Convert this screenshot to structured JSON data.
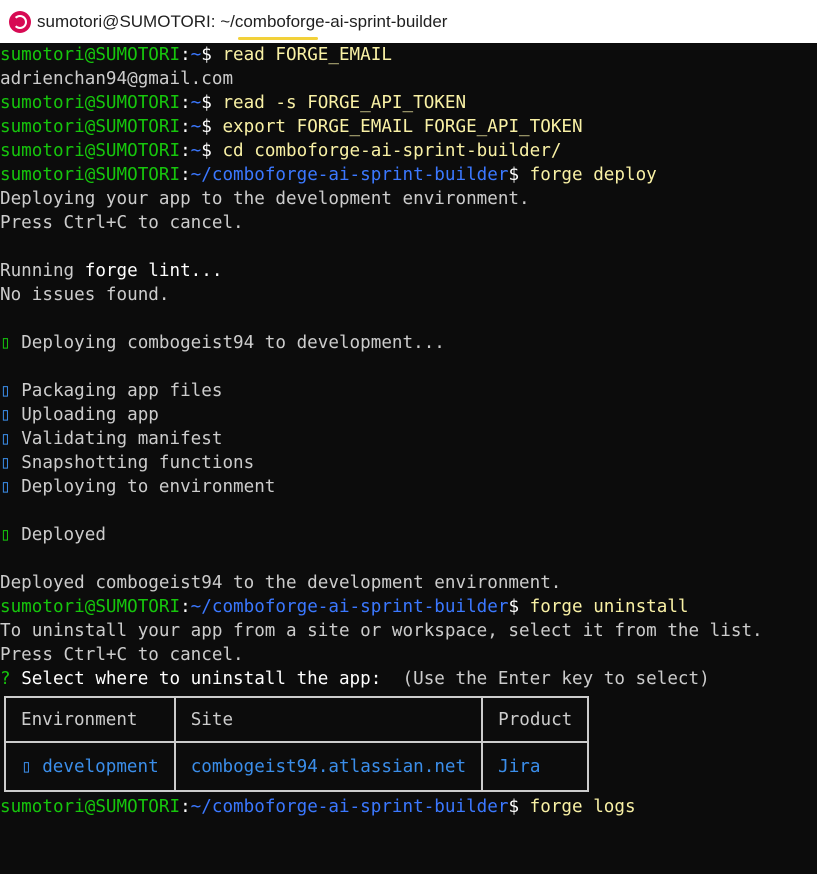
{
  "window": {
    "title": "sumotori@SUMOTORI: ~/comboforge-ai-sprint-builder"
  },
  "prompt": {
    "user": "sumotori@SUMOTORI",
    "home": "~",
    "project_dir": "~/comboforge-ai-sprint-builder",
    "sep": ":",
    "dollar": "$ "
  },
  "lines": {
    "cmd1": "read FORGE_EMAIL",
    "email": "adrienchan94@gmail.com",
    "cmd2": "read -s FORGE_API_TOKEN",
    "cmd3": "export FORGE_EMAIL FORGE_API_TOKEN",
    "cmd4": "cd comboforge-ai-sprint-builder/",
    "cmd5": "forge deploy",
    "deploy_msg1": "Deploying your app to the development environment.",
    "cancel": "Press Ctrl+C to cancel.",
    "lint_prefix": "Running ",
    "lint_cmd": "forge lint...",
    "lint_result": "No issues found.",
    "deploying": "Deploying combogeist94 to development...",
    "step1": "Packaging app files",
    "step2": "Uploading app",
    "step3": "Validating manifest",
    "step4": "Snapshotting functions",
    "step5": "Deploying to environment",
    "deployed": "Deployed",
    "deployed_final": "Deployed combogeist94 to the development environment.",
    "cmd6": "forge uninstall",
    "uninstall_msg": "To uninstall your app from a site or workspace, select it from the list.",
    "question_mark": "?",
    "select_prompt": "Select where to uninstall the app:",
    "select_hint": "(Use the Enter key to select)",
    "cmd7": "forge logs"
  },
  "icons": {
    "step_icon_glyph": "▯"
  },
  "table": {
    "headers": [
      "Environment",
      "Site",
      "Product"
    ],
    "rows": [
      [
        "development",
        "combogeist94.atlassian.net",
        "Jira"
      ]
    ]
  },
  "colors": {
    "prompt_user": "#16c60c",
    "prompt_path": "#3b78ff",
    "command": "#f9f1a5",
    "text": "#cccccc",
    "background": "#0c0c0c"
  }
}
